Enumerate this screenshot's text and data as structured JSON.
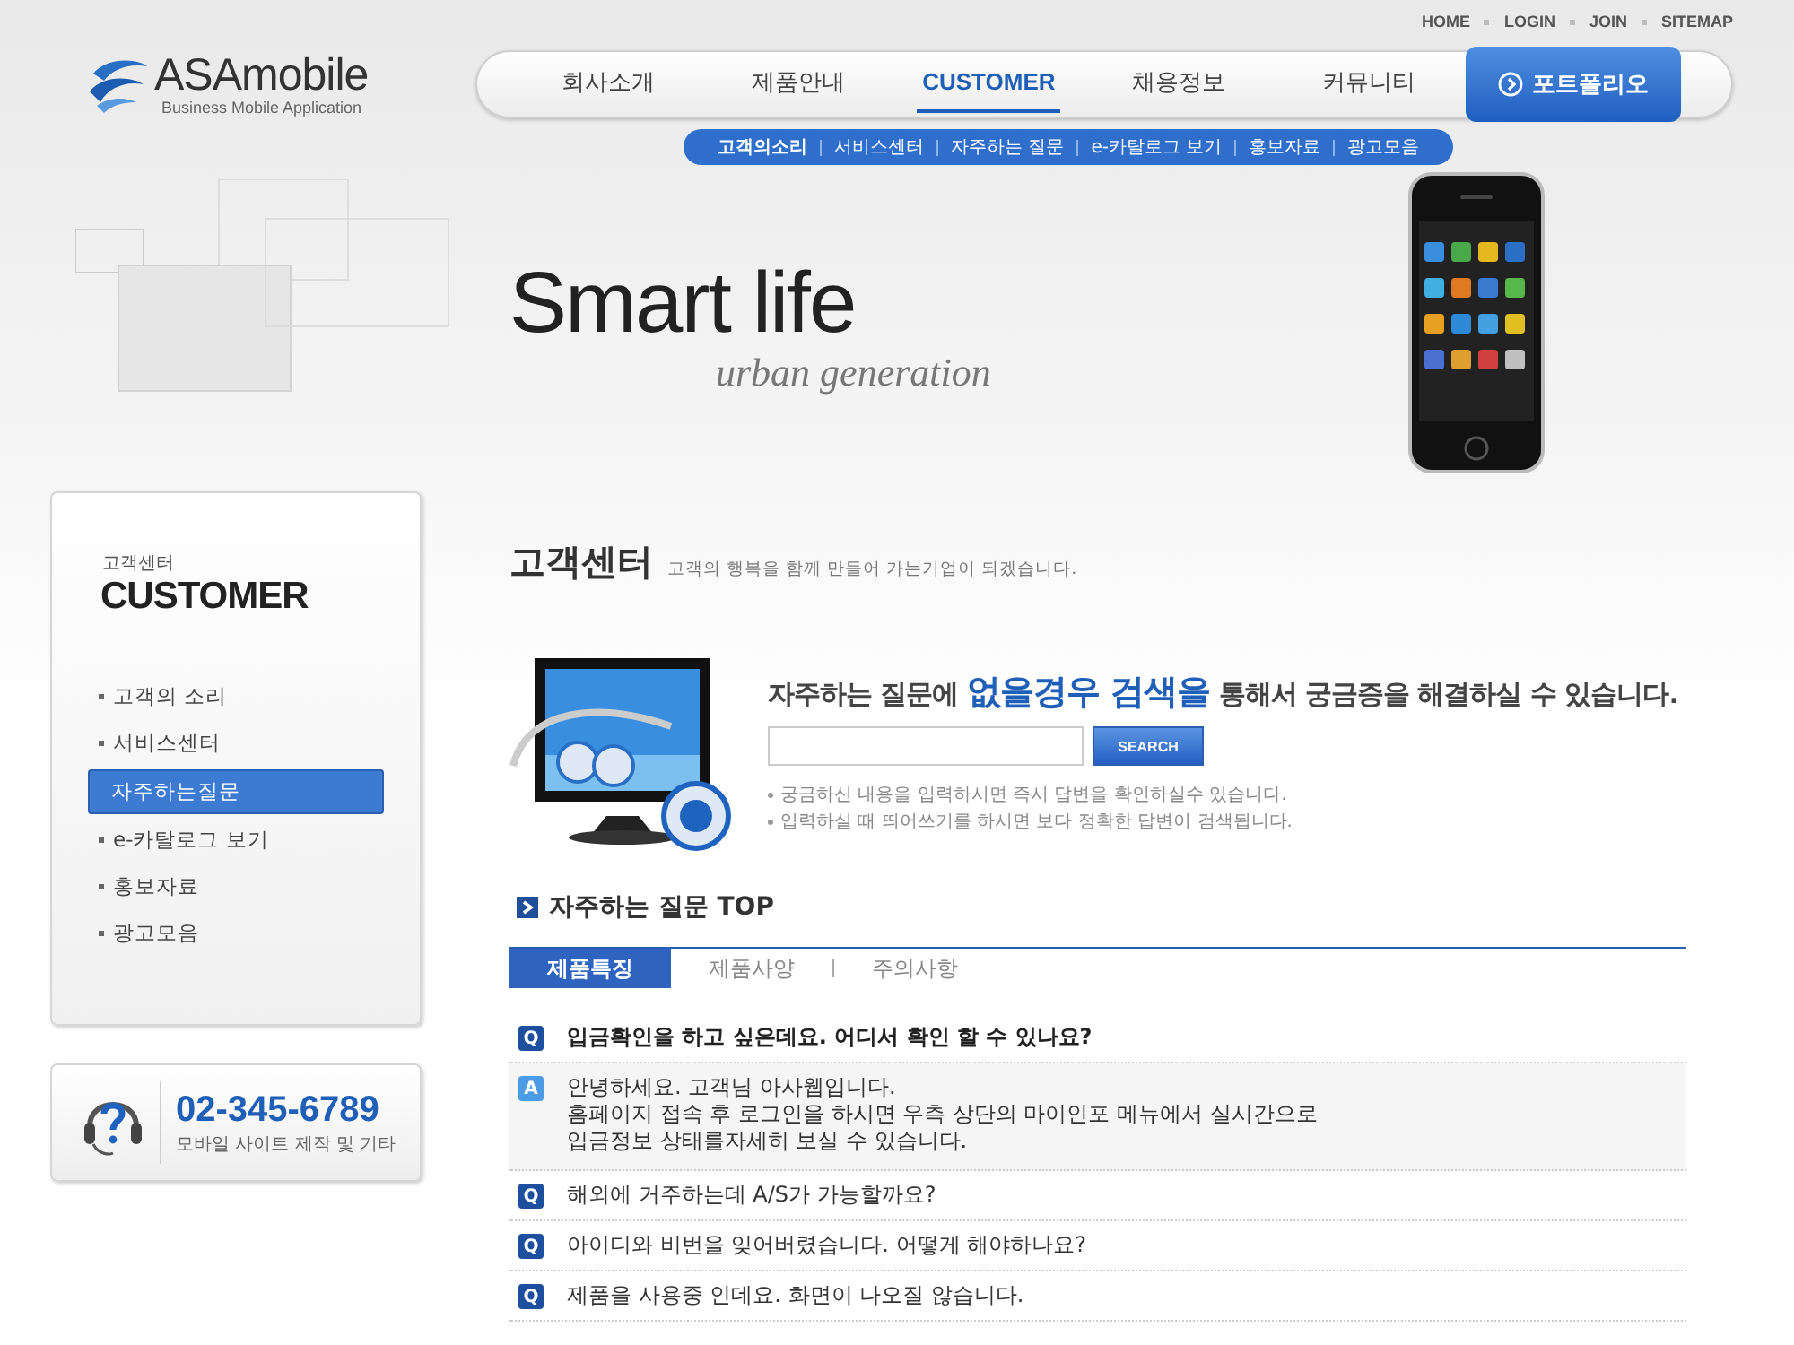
{
  "header": {
    "logo": {
      "name": "ASAmobile",
      "tagline": "Business Mobile Application"
    },
    "top_links": [
      "HOME",
      "LOGIN",
      "JOIN",
      "SITEMAP"
    ],
    "main_nav": [
      {
        "label": "회사소개",
        "selected": false
      },
      {
        "label": "제품안내",
        "selected": false
      },
      {
        "label": "CUSTOMER",
        "selected": true
      },
      {
        "label": "채용정보",
        "selected": false
      },
      {
        "label": "커뮤니티",
        "selected": false
      }
    ],
    "portfolio_button": "포트폴리오",
    "sub_nav": [
      {
        "label": "고객의소리",
        "selected": true
      },
      {
        "label": "서비스센터",
        "selected": false
      },
      {
        "label": "자주하는 질문",
        "selected": false
      },
      {
        "label": "e-카탈로그 보기",
        "selected": false
      },
      {
        "label": "홍보자료",
        "selected": false
      },
      {
        "label": "광고모음",
        "selected": false
      }
    ]
  },
  "banner": {
    "headline": "Smart life",
    "subline": "urban generation"
  },
  "sidebar": {
    "caption": "고객센터",
    "title": "CUSTOMER",
    "items": [
      {
        "label": "고객의 소리",
        "selected": false
      },
      {
        "label": "서비스센터",
        "selected": false
      },
      {
        "label": "자주하는질문",
        "selected": true
      },
      {
        "label": "e-카탈로그 보기",
        "selected": false
      },
      {
        "label": "홍보자료",
        "selected": false
      },
      {
        "label": "광고모음",
        "selected": false
      }
    ],
    "contact": {
      "phone": "02-345-6789",
      "note": "모바일 사이트 제작 및 기타"
    }
  },
  "page_title": {
    "title": "고객센터",
    "subtitle": "고객의 행복을 함께 만들어 가는기업이 되겠습니다."
  },
  "search": {
    "heading": "자주하는 질문에 **없을경우 검색을** 통해서 궁금증을 해결하실 수 있습니다.",
    "button": "SEARCH",
    "notes": [
      "궁금하신 내용을 입력하시면 즉시 답변을 확인하실수 있습니다.",
      "입력하실 때 띄어쓰기를 하시면 보다 정확한 답변이 검색됩니다."
    ]
  },
  "faq": {
    "title": "자주하는 질문 TOP",
    "tabs": [
      {
        "label": "제품특징",
        "selected": true
      },
      {
        "label": "제품사양",
        "selected": false
      },
      {
        "label": "주의사항",
        "selected": false
      }
    ],
    "items": [
      {
        "kind": "question",
        "marker": "Q",
        "text": "입금확인을 하고 싶은데요. 어디서 확인 할 수 있나요?",
        "expanded": true
      },
      {
        "kind": "answer",
        "marker": "A",
        "text": "안녕하세요. 고객님 아사웹입니다.\n홈페이지 접속 후 로그인을 하시면 우측 상단의 마이인포 메뉴에서 실시간으로\n입금정보 상태를자세히 보실 수 있습니다."
      },
      {
        "kind": "question",
        "marker": "Q",
        "text": "해외에 거주하는데 A/S가 가능할까요?",
        "expanded": false
      },
      {
        "kind": "question",
        "marker": "Q",
        "text": "아이디와 비번을 잊어버렸습니다. 어떻게 해야하나요?",
        "expanded": false
      },
      {
        "kind": "question",
        "marker": "Q",
        "text": "제품을 사용중 인데요. 화면이 나오질 않습니다.",
        "expanded": false
      }
    ]
  }
}
